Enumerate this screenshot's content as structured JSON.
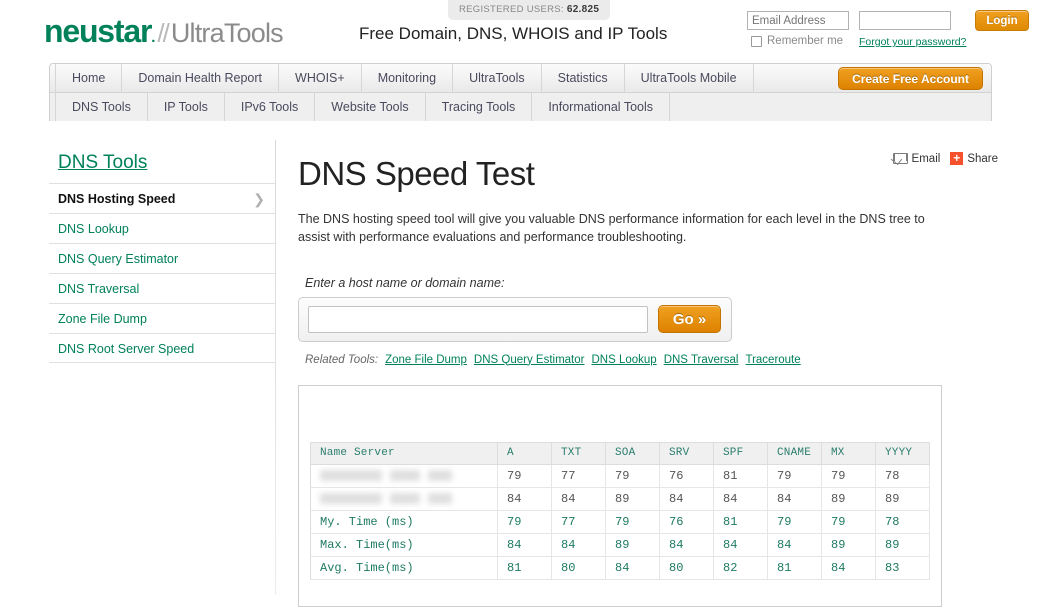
{
  "header": {
    "logo_primary": "neustar",
    "logo_dot": ".",
    "logo_slashes": "//",
    "logo_secondary": "UltraTools",
    "tagline": "Free Domain, DNS, WHOIS and IP Tools",
    "registered_users_label": "REGISTERED USERS:",
    "registered_users_count": "62.825",
    "login": {
      "email_placeholder": "Email Address",
      "password_placeholder": "",
      "remember_label": "Remember me",
      "forgot_link": "Forgot your password?",
      "login_button": "Login"
    }
  },
  "nav": {
    "primary": [
      "Home",
      "Domain Health Report",
      "WHOIS+",
      "Monitoring",
      "UltraTools",
      "Statistics",
      "UltraTools Mobile"
    ],
    "create_account_button": "Create Free Account",
    "secondary": [
      "DNS Tools",
      "IP Tools",
      "IPv6 Tools",
      "Website Tools",
      "Tracing Tools",
      "Informational Tools"
    ]
  },
  "sidebar": {
    "title": "DNS Tools",
    "items": [
      {
        "label": "DNS Hosting Speed",
        "active": true,
        "chevron": "❯"
      },
      {
        "label": "DNS Lookup",
        "active": false
      },
      {
        "label": "DNS Query Estimator",
        "active": false
      },
      {
        "label": "DNS Traversal",
        "active": false
      },
      {
        "label": "Zone File Dump",
        "active": false
      },
      {
        "label": "DNS Root Server Speed",
        "active": false
      }
    ]
  },
  "main": {
    "share": {
      "email_label": "Email",
      "share_label": "Share",
      "share_glyph": "+"
    },
    "title": "DNS Speed Test",
    "description": "The DNS hosting speed tool will give you valuable DNS performance information for each level in the DNS tree to assist with performance evaluations and performance troubleshooting.",
    "form_label": "Enter a host name or domain name:",
    "search_value": "",
    "search_placeholder": "",
    "go_button": "Go »",
    "related_tools_label": "Related Tools:",
    "related_tools": [
      "Zone File Dump",
      "DNS Query Estimator",
      "DNS Lookup",
      "DNS Traversal",
      "Traceroute"
    ]
  },
  "results": {
    "columns": [
      "Name Server",
      "A",
      "TXT",
      "SOA",
      "SRV",
      "SPF",
      "CNAME",
      "MX",
      "YYYY"
    ],
    "rows": [
      {
        "type": "data",
        "name": "",
        "redacted": true,
        "values": [
          "79",
          "77",
          "79",
          "76",
          "81",
          "79",
          "79",
          "78"
        ]
      },
      {
        "type": "data",
        "name": "",
        "redacted": true,
        "values": [
          "84",
          "84",
          "89",
          "84",
          "84",
          "84",
          "89",
          "89"
        ]
      },
      {
        "type": "summary",
        "name": "My. Time (ms)",
        "redacted": false,
        "values": [
          "79",
          "77",
          "79",
          "76",
          "81",
          "79",
          "79",
          "78"
        ]
      },
      {
        "type": "summary",
        "name": "Max. Time(ms)",
        "redacted": false,
        "values": [
          "84",
          "84",
          "89",
          "84",
          "84",
          "84",
          "89",
          "89"
        ]
      },
      {
        "type": "summary",
        "name": "Avg. Time(ms)",
        "redacted": false,
        "values": [
          "81",
          "80",
          "84",
          "80",
          "82",
          "81",
          "84",
          "83"
        ]
      }
    ]
  },
  "colors": {
    "brand_green": "#00815a",
    "accent_orange": "#dd8200",
    "share_red": "#f4512c",
    "table_teal": "#1e7a62"
  }
}
